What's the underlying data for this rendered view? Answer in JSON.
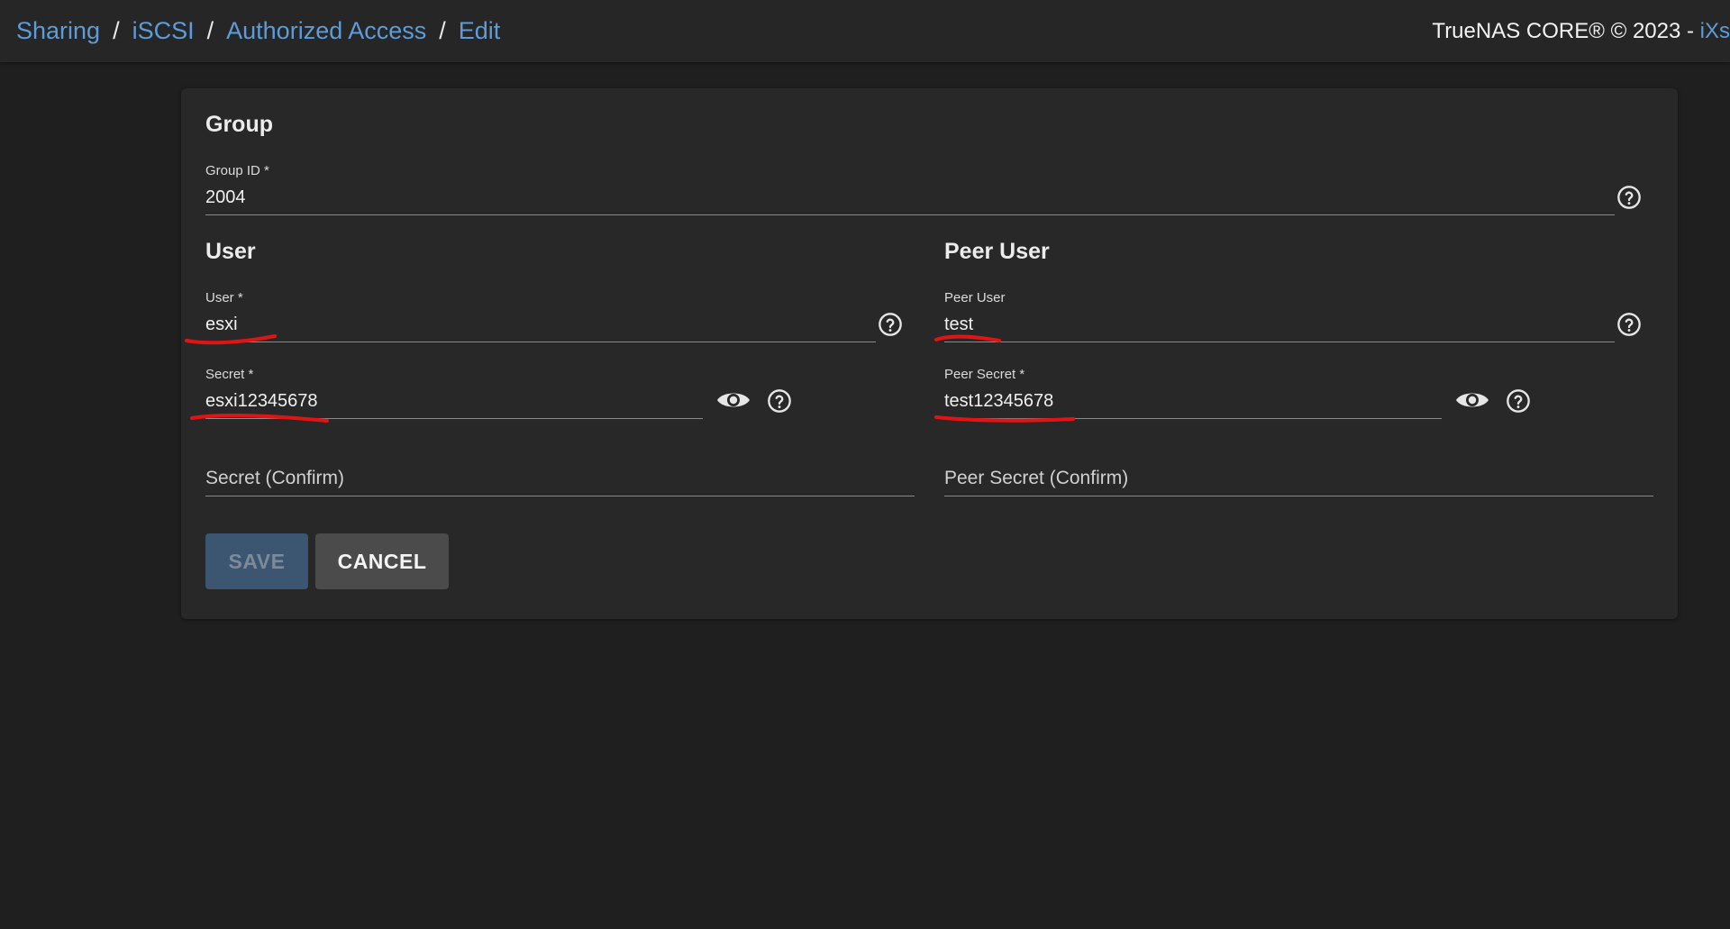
{
  "breadcrumb": {
    "items": [
      "Sharing",
      "iSCSI",
      "Authorized Access",
      "Edit"
    ],
    "separator": "/"
  },
  "copyright": {
    "text": "TrueNAS CORE® © 2023 - ",
    "link": "iXs"
  },
  "form": {
    "group": {
      "title": "Group",
      "group_id_label": "Group ID *",
      "group_id_value": "2004"
    },
    "user": {
      "title": "User",
      "user_label": "User *",
      "user_value": "esxi",
      "secret_label": "Secret *",
      "secret_value": "esxi12345678",
      "secret_confirm_placeholder": "Secret (Confirm)"
    },
    "peer_user": {
      "title": "Peer User",
      "peer_user_label": "Peer User",
      "peer_user_value": "test",
      "peer_secret_label": "Peer Secret *",
      "peer_secret_value": "test12345678",
      "peer_secret_confirm_placeholder": "Peer Secret (Confirm)"
    }
  },
  "buttons": {
    "save_label": "SAVE",
    "cancel_label": "CANCEL"
  },
  "icons": {
    "help": "help-circle-icon",
    "visibility": "eye-icon"
  },
  "colors": {
    "accent": "#5d9cd9",
    "annotation": "#e01414",
    "save_disabled_bg": "#3c5570",
    "cancel_bg": "#4b4b4b"
  }
}
